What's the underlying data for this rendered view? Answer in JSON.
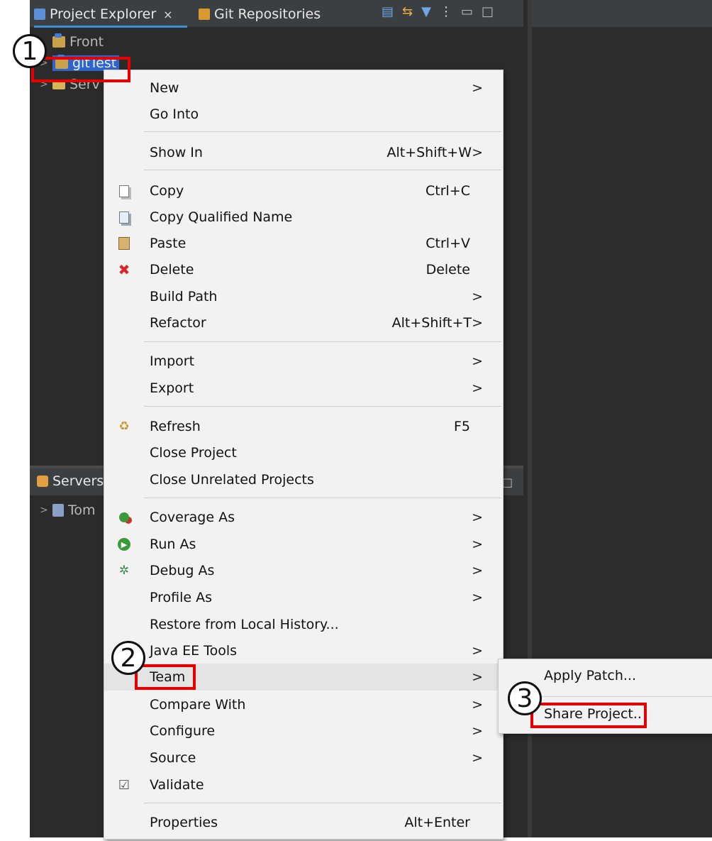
{
  "tabs": {
    "project_explorer": "Project Explorer",
    "close_glyph": "×",
    "git_repositories": "Git Repositories"
  },
  "tree": {
    "items": [
      "Front",
      "gitTest",
      "Serv"
    ]
  },
  "servers": {
    "title": "Servers",
    "item": "Tom"
  },
  "context_menu": {
    "items": [
      {
        "label": "New",
        "shortcut": "",
        "arrow": ">",
        "icon": ""
      },
      {
        "label": "Go Into",
        "shortcut": "",
        "arrow": "",
        "icon": ""
      },
      {
        "label": "Show In",
        "shortcut": "Alt+Shift+W",
        "arrow": ">",
        "icon": ""
      },
      {
        "label": "Copy",
        "shortcut": "Ctrl+C",
        "arrow": "",
        "icon": "copy-icon"
      },
      {
        "label": "Copy Qualified Name",
        "shortcut": "",
        "arrow": "",
        "icon": "copy-qualified-name-icon"
      },
      {
        "label": "Paste",
        "shortcut": "Ctrl+V",
        "arrow": "",
        "icon": "paste-icon"
      },
      {
        "label": "Delete",
        "shortcut": "Delete",
        "arrow": "",
        "icon": "delete-icon"
      },
      {
        "label": "Build Path",
        "shortcut": "",
        "arrow": ">",
        "icon": ""
      },
      {
        "label": "Refactor",
        "shortcut": "Alt+Shift+T",
        "arrow": ">",
        "icon": ""
      },
      {
        "label": "Import",
        "shortcut": "",
        "arrow": ">",
        "icon": ""
      },
      {
        "label": "Export",
        "shortcut": "",
        "arrow": ">",
        "icon": ""
      },
      {
        "label": "Refresh",
        "shortcut": "F5",
        "arrow": "",
        "icon": "refresh-icon"
      },
      {
        "label": "Close Project",
        "shortcut": "",
        "arrow": "",
        "icon": ""
      },
      {
        "label": "Close Unrelated Projects",
        "shortcut": "",
        "arrow": "",
        "icon": ""
      },
      {
        "label": "Coverage As",
        "shortcut": "",
        "arrow": ">",
        "icon": "coverage-icon"
      },
      {
        "label": "Run As",
        "shortcut": "",
        "arrow": ">",
        "icon": "run-icon"
      },
      {
        "label": "Debug As",
        "shortcut": "",
        "arrow": ">",
        "icon": "debug-icon"
      },
      {
        "label": "Profile As",
        "shortcut": "",
        "arrow": ">",
        "icon": ""
      },
      {
        "label": "Restore from Local History...",
        "shortcut": "",
        "arrow": "",
        "icon": ""
      },
      {
        "label": "Java EE Tools",
        "shortcut": "",
        "arrow": ">",
        "icon": ""
      },
      {
        "label": "Team",
        "shortcut": "",
        "arrow": ">",
        "icon": ""
      },
      {
        "label": "Compare With",
        "shortcut": "",
        "arrow": ">",
        "icon": ""
      },
      {
        "label": "Configure",
        "shortcut": "",
        "arrow": ">",
        "icon": ""
      },
      {
        "label": "Source",
        "shortcut": "",
        "arrow": ">",
        "icon": ""
      },
      {
        "label": "Validate",
        "shortcut": "",
        "arrow": "",
        "icon": "checkbox-icon"
      },
      {
        "label": "Properties",
        "shortcut": "Alt+Enter",
        "arrow": "",
        "icon": ""
      }
    ]
  },
  "submenu": {
    "apply_patch": "Apply Patch...",
    "share_project": "Share Project.."
  },
  "annotations": {
    "step1": "1",
    "step2": "2",
    "step3": "3"
  },
  "colors": {
    "highlight_red": "#e60000",
    "selection_blue": "#2f65ca",
    "ide_dark": "#2b2b2b"
  }
}
